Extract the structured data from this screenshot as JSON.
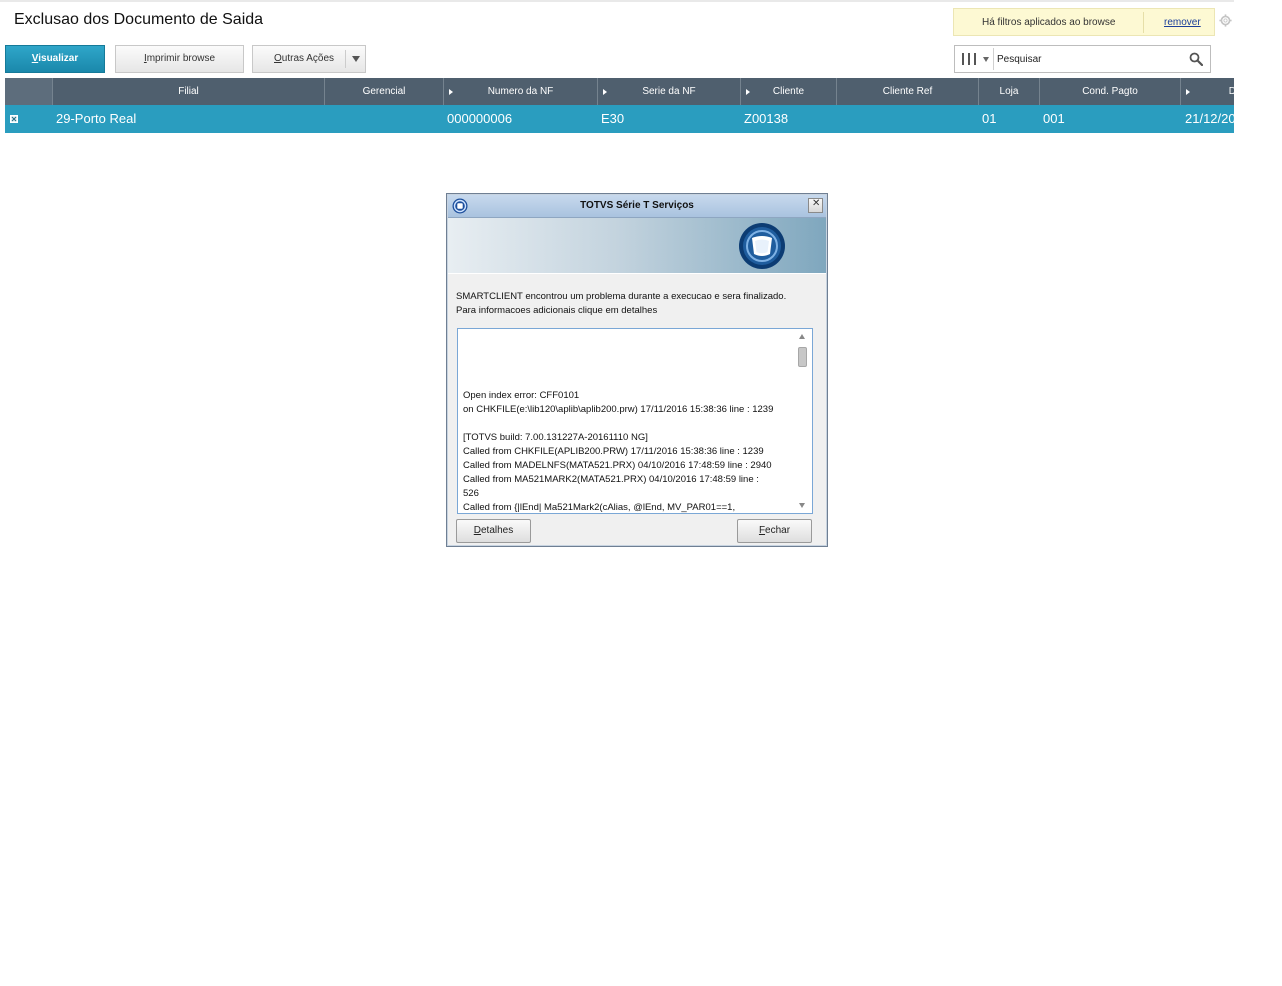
{
  "page": {
    "title": "Exclusao dos Documento de Saida"
  },
  "filter_notice": {
    "text": "Há filtros aplicados ao browse",
    "remove_link": "remover"
  },
  "toolbar": {
    "view_first": "V",
    "view_rest": "isualizar",
    "print_first": "I",
    "print_rest": "mprimir browse",
    "other_first": "O",
    "other_rest": "utras Ações"
  },
  "search": {
    "placeholder": "Pesquisar"
  },
  "grid": {
    "columns": [
      {
        "label": "Filial",
        "sortable": false
      },
      {
        "label": "Gerencial",
        "sortable": false
      },
      {
        "label": "Numero da NF",
        "sortable": true
      },
      {
        "label": "Serie da NF",
        "sortable": true
      },
      {
        "label": "Cliente",
        "sortable": true
      },
      {
        "label": "Cliente Ref",
        "sortable": false
      },
      {
        "label": "Loja",
        "sortable": false
      },
      {
        "label": "Cond. Pagto",
        "sortable": false
      },
      {
        "label": "D",
        "sortable": true
      }
    ],
    "rows": [
      {
        "filial": "29-Porto Real",
        "gerencial": "",
        "numero_nf": "000000006",
        "serie_nf": "E30",
        "cliente": "Z00138",
        "cliente_ref": "",
        "loja": "01",
        "cond_pagto": "001",
        "data": "21/12/20"
      }
    ]
  },
  "dialog": {
    "title": "TOTVS Série T Serviços",
    "message": [
      "SMARTCLIENT encontrou um problema durante a execucao e sera finalizado.",
      "Para informacoes adicionais clique em detalhes"
    ],
    "details_lines": [
      "Open index error: CFF0101",
      " on CHKFILE(e:\\lib120\\aplib\\aplib200.prw) 17/11/2016 15:38:36 line : 1239",
      "",
      "[TOTVS build: 7.00.131227A-20161110 NG]",
      "Called from CHKFILE(APLIB200.PRW) 17/11/2016 15:38:36 line : 1239",
      "Called from MADELNFS(MATA521.PRX) 04/10/2016 17:48:59 line : 2940",
      "Called from MA521MARK2(MATA521.PRX) 04/10/2016 17:48:59 line :",
      "526",
      "Called from {|lEnd| Ma521Mark2(cAlias, @lEnd, MV_PAR01==1,"
    ],
    "details_button_first": "D",
    "details_button_rest": "etalhes",
    "close_button_first": "F",
    "close_button_rest": "echar"
  },
  "colors": {
    "accent": "#2a9dbf",
    "header": "#4f5f6e",
    "notice_bg": "#fdf9d3"
  }
}
